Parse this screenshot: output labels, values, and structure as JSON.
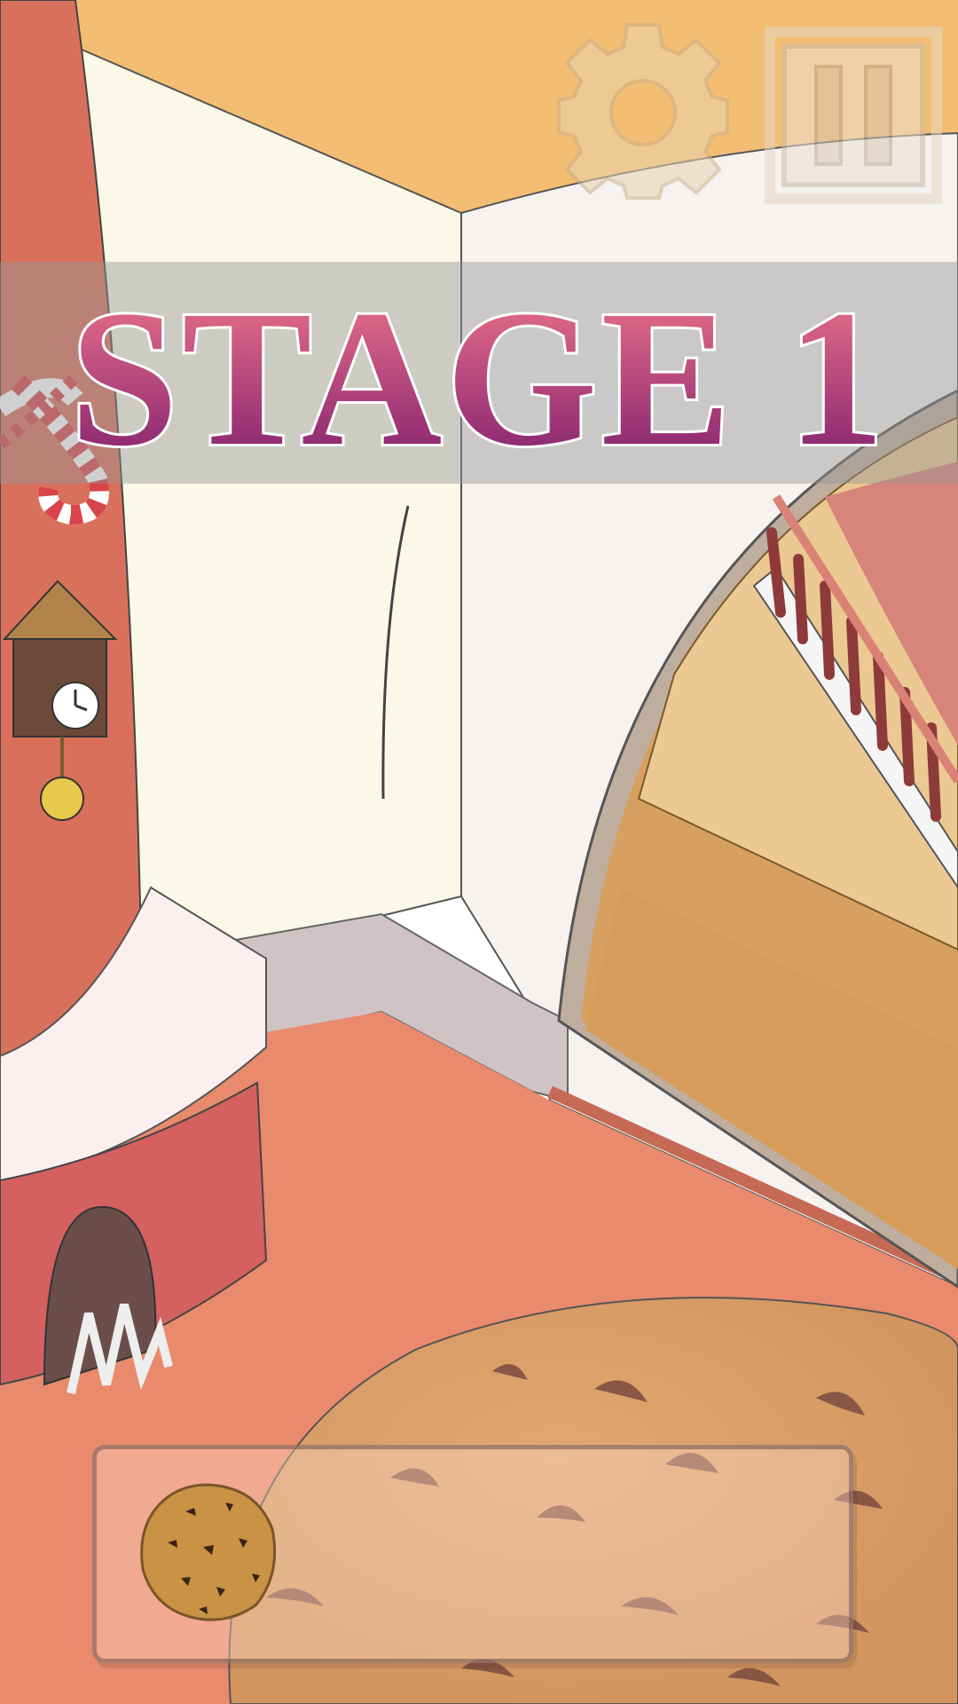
{
  "hud": {
    "stage_title": "STAGE 1",
    "settings_icon": "gear-icon",
    "pause_icon": "pause-icon"
  },
  "inventory": {
    "items": [
      {
        "name": "cookie",
        "icon": "cookie-icon"
      }
    ]
  },
  "colors": {
    "title_top": "#F2788A",
    "title_bottom": "#7A1A6E",
    "banner": "#969696",
    "floor": "#E98A6C"
  }
}
